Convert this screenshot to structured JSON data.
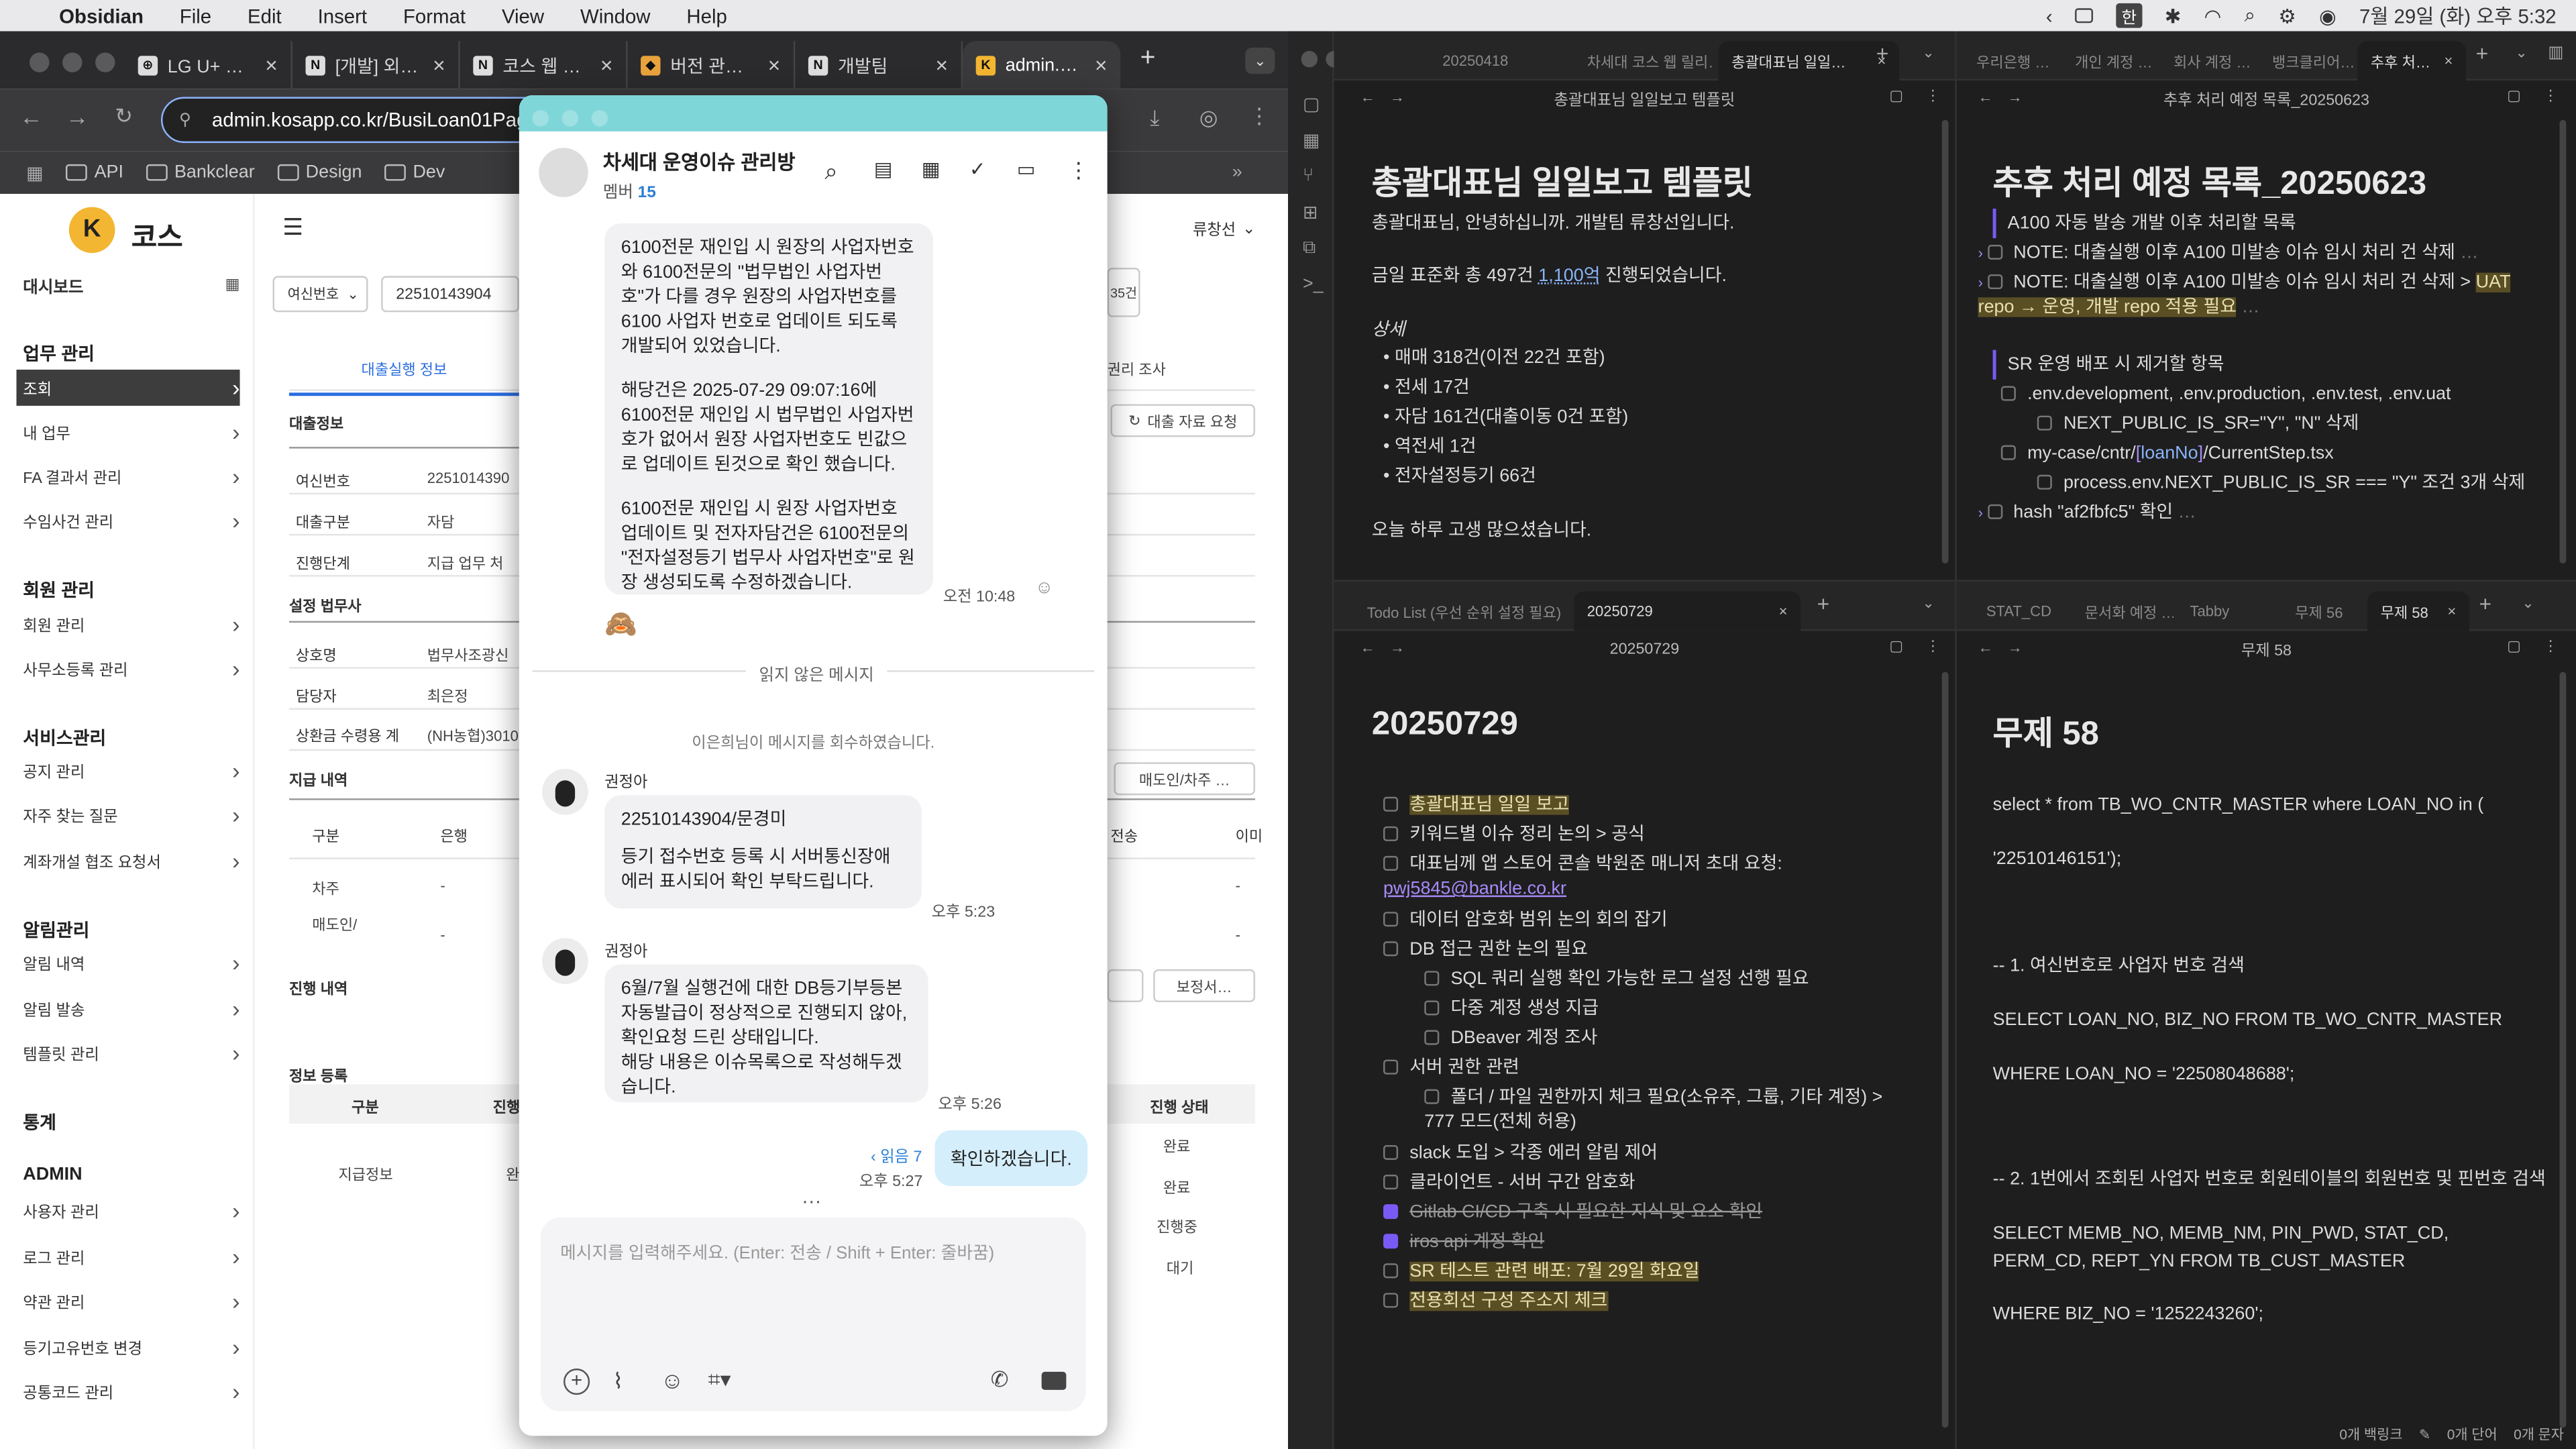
{
  "menubar": {
    "app": "Obsidian",
    "items": [
      "File",
      "Edit",
      "Insert",
      "Format",
      "View",
      "Window",
      "Help"
    ],
    "clock": "7월 29일 (화) 오후 5:32",
    "lang": "한"
  },
  "browser": {
    "tabs": [
      "LG U+ 콜…",
      "[개발] 외부…",
      "코스 웹 릴리…",
      "버전 관리 2…",
      "개발팀",
      "admin.ko…"
    ],
    "url": "admin.kosapp.co.kr/BusiLoan01Pag",
    "bookmarks": [
      "API",
      "Bankclear",
      "Design",
      "Dev"
    ]
  },
  "admin": {
    "brand": "코스",
    "user": "류창선",
    "dashboard": "대시보드",
    "sections": [
      {
        "title": "업무 관리",
        "items": [
          "조회",
          "내 업무",
          "FA 결과서 관리",
          "수임사건 관리"
        ]
      },
      {
        "title": "회원 관리",
        "items": [
          "회원 관리",
          "사무소등록 관리"
        ]
      },
      {
        "title": "서비스관리",
        "items": [
          "공지 관리",
          "자주 찾는 질문",
          "계좌개설 협조 요청서"
        ]
      },
      {
        "title": "알림관리",
        "items": [
          "알림 내역",
          "알림 발송",
          "템플릿 관리"
        ]
      },
      {
        "title": "통계",
        "items": []
      },
      {
        "title": "ADMIN",
        "items": [
          "사용자 관리",
          "로그 관리",
          "약관 관리",
          "등기고유번호 변경",
          "공통코드 관리"
        ]
      }
    ],
    "search_select": "여신번호",
    "search_value": "22510143904",
    "badge": "35건",
    "tab_active": "대출실행 정보",
    "tab_right": "권리 조사",
    "btn_request": "대출 자료 요청",
    "loan_section": "대출정보",
    "loan_rows": [
      [
        "여신번호",
        "2251014390"
      ],
      [
        "대출구분",
        "자담"
      ],
      [
        "진행단계",
        "지급 업무 처"
      ]
    ],
    "law_section": "설정 법무사",
    "law_rows": [
      [
        "상호명",
        "법무사조광신"
      ],
      [
        "담당자",
        "최은정"
      ],
      [
        "상환금 수령용 계",
        "(NH농협)3010"
      ]
    ],
    "pay_section": "지급 내역",
    "btn_seller": "매도인/차주 …",
    "pay_headers": [
      "구분",
      "은행",
      "전송",
      "이미"
    ],
    "pay_rows": [
      [
        "차주",
        "-",
        "-"
      ],
      [
        "매도인/",
        "-",
        "-"
      ]
    ],
    "progress_section": "진행 내역",
    "btn_correct": "보정서…",
    "reg_section": "정보 등록",
    "reg_headers": [
      "구분",
      "진행",
      "진행 상태"
    ],
    "reg_rows": [
      [
        "지급정보",
        "완"
      ],
      [
        "",
        "완료"
      ],
      [
        "",
        "완료"
      ],
      [
        "",
        "진행중"
      ],
      [
        "",
        "대기"
      ]
    ]
  },
  "chat": {
    "title": "차세대 운영이슈 관리방",
    "members_label": "멤버",
    "members": "15",
    "msg1": [
      "6100전문 재인입 시 원장의 사업자번호와 6100전문의 \"법무법인 사업자번호\"가 다를 경우 원장의 사업자번호를 6100 사업자 번호로 업데이트 되도록 개발되어 있었습니다.",
      "",
      "해당건은 2025-07-29 09:07:16에 6100전문 재인입 시 법무법인 사업자번호가 없어서 원장 사업자번호도 빈값으로 업데이트 된것으로 확인 했습니다.",
      "",
      "6100전문 재인입 시 원장 사업자번호 업데이트 및 전자자담건은 6100전문의 \"전자설정등기 법무사 사업자번호\"로 원장 생성되도록 수정하겠습니다."
    ],
    "msg1_time": "오전 10:48",
    "unread": "읽지 않은 메시지",
    "recall": "이은희님이 메시지를 회수하였습니다.",
    "sender": "권정아",
    "msg2": [
      "22510143904/문경미",
      "",
      "등기 접수번호 등록 시 서버통신장애 에러 표시되어 확인 부탁드립니다."
    ],
    "msg2_time": "오후 5:23",
    "msg3": [
      "6월/7월 실행건에 대한 DB등기부등본 자동발급이 정상적으로 진행되지 않아, 확인요청 드린 상태입니다.",
      "해당 내용은 이슈목록으로 작성해두겠습니다."
    ],
    "msg3_time": "오후 5:26",
    "mine": "확인하겠습니다.",
    "mine_read": "읽음 7",
    "mine_time": "오후 5:27",
    "placeholder": "메시지를 입력해주세요. (Enter: 전송 / Shift + Enter: 줄바꿈)"
  },
  "obsidian": {
    "tl_tabs": [
      "20250418",
      "차세대 코스 웹 릴리…",
      "총괄대표님 일일…"
    ],
    "tl_head": "총괄대표님 일일보고 템플릿",
    "tl_title": "총괄대표님 일일보고 템플릿",
    "tl_lines": [
      "총괄대표님, 안녕하십니까. 개발팀 류창선입니다.",
      "금일 표준화 총 497건 ",
      "1,100억",
      "진행되었습니다.",
      "상세",
      "매매 318건(이전 22건 포함)",
      "전세 17건",
      "자담 161건(대출이동 0건 포함)",
      "역전세 1건",
      "전자설정등기 66건",
      "오늘 하루 고생 많으셨습니다."
    ],
    "tr_tabs": [
      "우리은행 …",
      "개인 계정 …",
      "회사 계정 …",
      "뱅크클리어…",
      "추후 처…"
    ],
    "tr_head": "추후 처리 예정 목록_20250623",
    "tr_title": "추후 처리 예정 목록_20250623",
    "tr_lines": [
      "A100 자동 발송 개발 이후 처리할 목록",
      "NOTE: 대출실행 이후 A100 미발송 이슈 임시 처리 건 삭제",
      "NOTE: 대출실행 이후 A100 미발송 이슈 임시 처리 건 삭제 > ",
      "UAT repo → 운영, 개발 repo 적용 필요",
      "SR 운영 배포 시 제거할 항목",
      ".env.development, .env.production, .env.test, .env.uat",
      "NEXT_PUBLIC_IS_SR=\"Y\", \"N\" 삭제",
      "my-case/cntr/",
      "loanNo",
      "/CurrentStep.tsx",
      "process.env.NEXT_PUBLIC_IS_SR === \"Y\" 조건 3개 삭제",
      "hash \"af2fbfc5\" 확인"
    ],
    "bl_tabs": [
      "Todo List (우선 순위 설정 필요)",
      "20250729"
    ],
    "bl_head": "20250729",
    "bl_title": "20250729",
    "todos": [
      {
        "t": "총괄대표님 일일 보고",
        "hl": true
      },
      {
        "t": "키워드별 이슈 정리 논의 > 공식"
      },
      {
        "t": "대표님께 앱 스토어 콘솔 박원준 매니저 초대 요청: ",
        "link": "pwj5845@bankle.co.kr"
      },
      {
        "t": "데이터 암호화 범위 논의 회의 잡기"
      },
      {
        "t": "DB 접근 권한 논의 필요"
      },
      {
        "t": "SQL 쿼리 실행 확인 가능한 로그 설정 선행 필요",
        "sub": true
      },
      {
        "t": "다중 계정 생성 지급",
        "sub": true
      },
      {
        "t": "DBeaver 계정 조사",
        "sub": true
      },
      {
        "t": "서버 권한 관련"
      },
      {
        "t": "폴더 / 파일 권한까지 체크 필요(소유주, 그룹, 기타 계정) > 777 모드(전체 허용)",
        "sub": true
      },
      {
        "t": "slack 도입 > 각종 에러 알림 제어"
      },
      {
        "t": "클라이언트 - 서버 구간 암호화"
      },
      {
        "t": "Gitlab CI/CD 구축 시 필요한 지식 및 요소 확인",
        "done": true
      },
      {
        "t": "iros api 계정 확인",
        "done": true
      },
      {
        "t": "SR 테스트 관련 배포: 7월 29일 화요일",
        "hl": true
      },
      {
        "t": "전용회선 구성 주소지 체크",
        "hl": true
      }
    ],
    "br_tabs": [
      "STAT_CD",
      "문서화 예정 …",
      "Tabby",
      "무제 56",
      "무제 58"
    ],
    "br_head": "무제 58",
    "br_title": "무제 58",
    "sql": [
      "select * from TB_WO_CNTR_MASTER where LOAN_NO in (",
      "'22510146151');",
      "",
      "-- 1. 여신번호로 사업자 번호 검색",
      "SELECT LOAN_NO, BIZ_NO FROM TB_WO_CNTR_MASTER",
      "WHERE LOAN_NO = '22508048688';",
      "",
      "-- 2.  1번에서 조회된 사업자 번호로 회원테이블의 회원번호 및 핀번호 검색",
      "SELECT MEMB_NO, MEMB_NM, PIN_PWD, STAT_CD,",
      "PERM_CD, REPT_YN FROM TB_CUST_MASTER",
      "WHERE BIZ_NO = '1252243260';"
    ],
    "status": [
      "0개 백링크",
      "0개 단어",
      "0개 문자"
    ]
  }
}
